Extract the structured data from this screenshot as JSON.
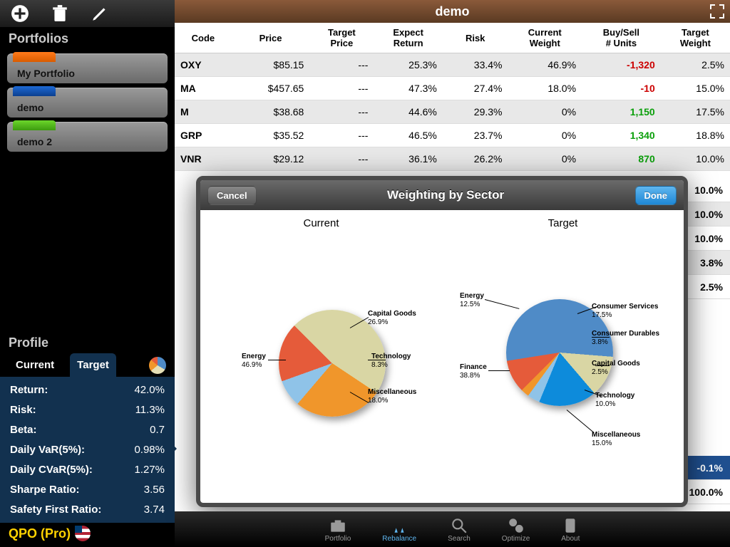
{
  "sidebar": {
    "section_label": "Portfolios",
    "portfolios": [
      {
        "name": "My Portfolio"
      },
      {
        "name": "demo"
      },
      {
        "name": "demo 2"
      }
    ],
    "profile_label": "Profile",
    "tabs": {
      "current": "Current",
      "target": "Target"
    },
    "metrics": [
      {
        "k": "Return:",
        "v": "42.0%"
      },
      {
        "k": "Risk:",
        "v": "11.3%"
      },
      {
        "k": "Beta:",
        "v": "0.7"
      },
      {
        "k": "Daily VaR(5%):",
        "v": "0.98%"
      },
      {
        "k": "Daily CVaR(5%):",
        "v": "1.27%"
      },
      {
        "k": "Sharpe Ratio:",
        "v": "3.56"
      },
      {
        "k": "Safety First Ratio:",
        "v": "3.74"
      }
    ],
    "brand": "QPO (Pro)"
  },
  "header": {
    "title": "demo"
  },
  "columns": [
    "Code",
    "Price",
    "Target Price",
    "Expect Return",
    "Risk",
    "Current Weight",
    "Buy/Sell # Units",
    "Target Weight"
  ],
  "rows": [
    {
      "code": "OXY",
      "price": "$85.15",
      "tp": "---",
      "er": "25.3%",
      "risk": "33.4%",
      "cw": "46.9%",
      "bs": "-1,320",
      "bs_sign": "neg",
      "tw": "2.5%"
    },
    {
      "code": "MA",
      "price": "$457.65",
      "tp": "---",
      "er": "47.3%",
      "risk": "27.4%",
      "cw": "18.0%",
      "bs": "-10",
      "bs_sign": "neg",
      "tw": "15.0%"
    },
    {
      "code": "M",
      "price": "$38.68",
      "tp": "---",
      "er": "44.6%",
      "risk": "29.3%",
      "cw": "0%",
      "bs": "1,150",
      "bs_sign": "pos",
      "tw": "17.5%"
    },
    {
      "code": "GRP",
      "price": "$35.52",
      "tp": "---",
      "er": "46.5%",
      "risk": "23.7%",
      "cw": "0%",
      "bs": "1,340",
      "bs_sign": "pos",
      "tw": "18.8%"
    },
    {
      "code": "VNR",
      "price": "$29.12",
      "tp": "---",
      "er": "36.1%",
      "risk": "26.2%",
      "cw": "0%",
      "bs": "870",
      "bs_sign": "pos",
      "tw": "10.0%"
    }
  ],
  "tail_weights": [
    "10.0%",
    "10.0%",
    "10.0%",
    "3.8%",
    "2.5%"
  ],
  "summary": {
    "delta": "-0.1%",
    "total": "100.0%"
  },
  "modal": {
    "cancel": "Cancel",
    "done": "Done",
    "title": "Weighting by Sector",
    "current_label": "Current",
    "target_label": "Target"
  },
  "chart_data": [
    {
      "type": "pie",
      "title": "Current",
      "series": [
        {
          "name": "Energy",
          "value": 46.9,
          "color": "#d9d6a4"
        },
        {
          "name": "Capital Goods",
          "value": 26.9,
          "color": "#f0962b"
        },
        {
          "name": "Technology",
          "value": 8.3,
          "color": "#8fc3e8"
        },
        {
          "name": "Miscellaneous",
          "value": 18.0,
          "color": "#e55b3a"
        }
      ]
    },
    {
      "type": "pie",
      "title": "Target",
      "series": [
        {
          "name": "Finance",
          "value": 38.8,
          "color": "#4f8bc7"
        },
        {
          "name": "Energy",
          "value": 12.5,
          "color": "#d9d6a4"
        },
        {
          "name": "Consumer Services",
          "value": 17.5,
          "color": "#0d8bdb"
        },
        {
          "name": "Consumer Durables",
          "value": 3.8,
          "color": "#8fc3e8"
        },
        {
          "name": "Capital Goods",
          "value": 2.5,
          "color": "#f0962b"
        },
        {
          "name": "Technology",
          "value": 10.0,
          "color": "#e55b3a"
        },
        {
          "name": "Miscellaneous",
          "value": 15.0,
          "color": "#4f8bc7"
        }
      ]
    }
  ],
  "tabs": {
    "portfolio": "Portfolio",
    "rebalance": "Rebalance",
    "search": "Search",
    "optimize": "Optimize",
    "about": "About"
  }
}
